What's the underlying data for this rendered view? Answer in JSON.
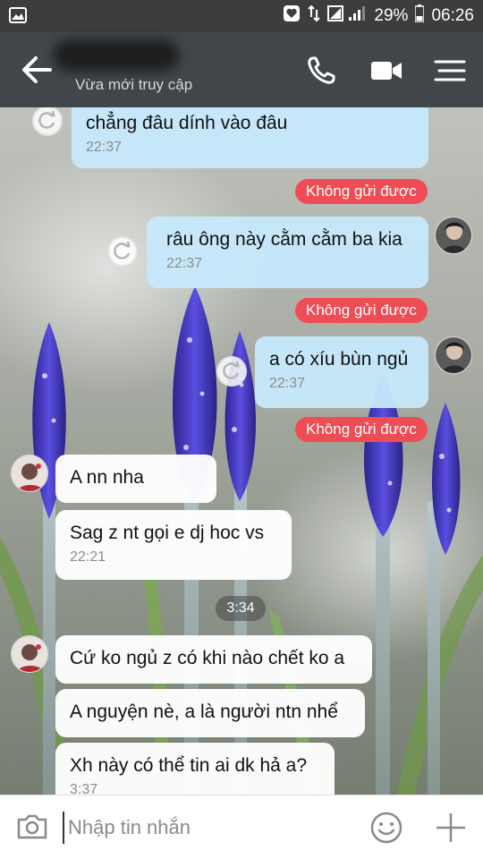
{
  "status_bar": {
    "battery_percent": "29%",
    "time": "06:26",
    "left_icon": "image-notification-icon",
    "right_icons": [
      "heart-app-icon",
      "data-arrows-icon",
      "signal-icon",
      "battery-icon"
    ]
  },
  "header": {
    "subtitle": "Vừa mới truy cập",
    "icons": [
      "back-arrow-icon",
      "phone-icon",
      "video-camera-icon",
      "menu-icon"
    ]
  },
  "messages": [
    {
      "type": "out",
      "text": "chẳng đâu dính vào đâu",
      "time": "22:37",
      "status": "Không gửi được"
    },
    {
      "type": "out",
      "text": "râu ông này cằm cằm ba kia",
      "time": "22:37",
      "status": "Không gửi được"
    },
    {
      "type": "out",
      "text": "a có xíu bùn ngủ",
      "time": "22:37",
      "status": "Không gửi được"
    },
    {
      "type": "in",
      "text": "A nn nha"
    },
    {
      "type": "in",
      "text": "Sag z nt gọi e dj hoc vs",
      "time": "22:21"
    },
    {
      "type": "separator",
      "text": "3:34"
    },
    {
      "type": "in",
      "text": "Cứ ko ngủ z có khi nào chết ko a"
    },
    {
      "type": "in",
      "text": "A nguyện nè, a là người ntn nhể"
    },
    {
      "type": "in",
      "text": "Xh này có thể tin ai dk hả a?",
      "time": "3:37"
    }
  ],
  "input": {
    "placeholder": "Nhập tin nhắn",
    "icons": [
      "camera-icon",
      "emoji-icon",
      "plus-icon"
    ]
  },
  "colors": {
    "header_bg": "#373c42",
    "outgoing_bubble": "#c6e9fc",
    "incoming_bubble": "#ffffff",
    "error_badge": "#ef4d55",
    "flower_purple": "#4a3fc8"
  }
}
